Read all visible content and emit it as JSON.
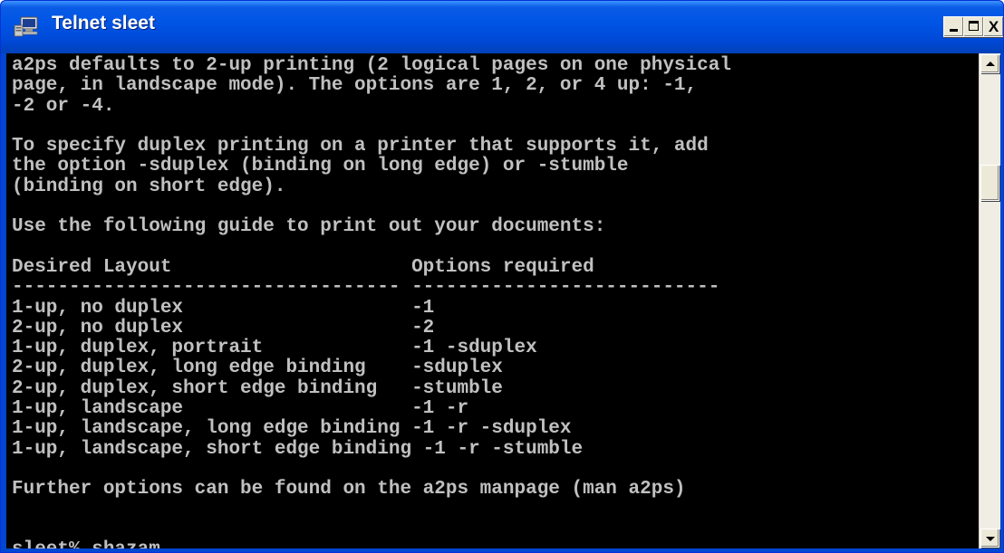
{
  "window": {
    "title": "Telnet sleet",
    "app_icon": "telnet-computer-icon",
    "controls": {
      "minimize_icon": "minimize-icon",
      "maximize_icon": "maximize-icon",
      "close_icon": "close-icon",
      "close_glyph": "X"
    }
  },
  "console": {
    "colors": {
      "background": "#000000",
      "text": "#c0c0c0"
    },
    "lines": [
      "a2ps defaults to 2-up printing (2 logical pages on one physical",
      "page, in landscape mode). The options are 1, 2, or 4 up: -1,",
      "-2 or -4.",
      "",
      "To specify duplex printing on a printer that supports it, add",
      "the option -sduplex (binding on long edge) or -stumble",
      "(binding on short edge).",
      "",
      "Use the following guide to print out your documents:",
      "",
      "Desired Layout                     Options required",
      "---------------------------------- ---------------------------",
      "1-up, no duplex                    -1",
      "2-up, no duplex                    -2",
      "1-up, duplex, portrait             -1 -sduplex",
      "2-up, duplex, long edge binding    -sduplex",
      "2-up, duplex, short edge binding   -stumble",
      "1-up, landscape                    -1 -r",
      "1-up, landscape, long edge binding -1 -r -sduplex",
      "1-up, landscape, short edge binding -1 -r -stumble",
      "",
      "Further options can be found on the a2ps manpage (man a2ps)",
      "",
      "",
      "sleet% shazam"
    ]
  },
  "scrollbar": {
    "up_icon": "scroll-up-arrow-icon",
    "down_icon": "scroll-down-arrow-icon"
  }
}
